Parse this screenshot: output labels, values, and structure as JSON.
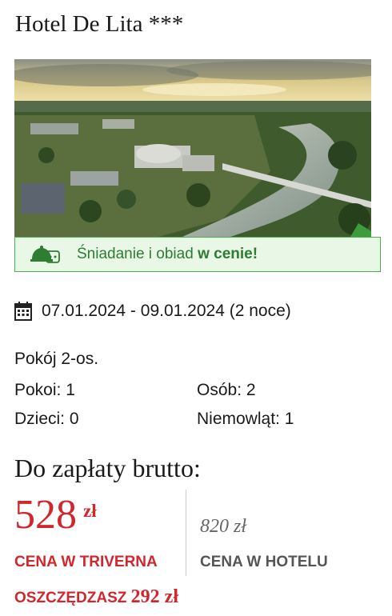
{
  "hotel": {
    "name": "Hotel De Lita ***"
  },
  "promo": {
    "prefix": "Śniadanie i obiad",
    "highlight": "w cenie!",
    "icon": "meal-bread-icon",
    "color": "#2e7d32"
  },
  "stay": {
    "dates": "07.01.2024 - 09.01.2024 (2 noce)",
    "icon": "calendar-icon"
  },
  "room": {
    "type": "Pokój 2-os.",
    "rooms": "Pokoi: 1",
    "persons": "Osób: 2",
    "children": "Dzieci: 0",
    "infants": "Niemowląt: 1"
  },
  "payment": {
    "title": "Do zapłaty brutto:",
    "triverna_price": "528",
    "triverna_currency": "zł",
    "triverna_label": "CENA W TRIVERNA",
    "hotel_price": "820 zł",
    "hotel_label": "CENA W HOTELU",
    "savings_prefix": "OSZCZĘDZASZ",
    "savings_amount": "292 zł",
    "accent_color": "#d2262d"
  }
}
